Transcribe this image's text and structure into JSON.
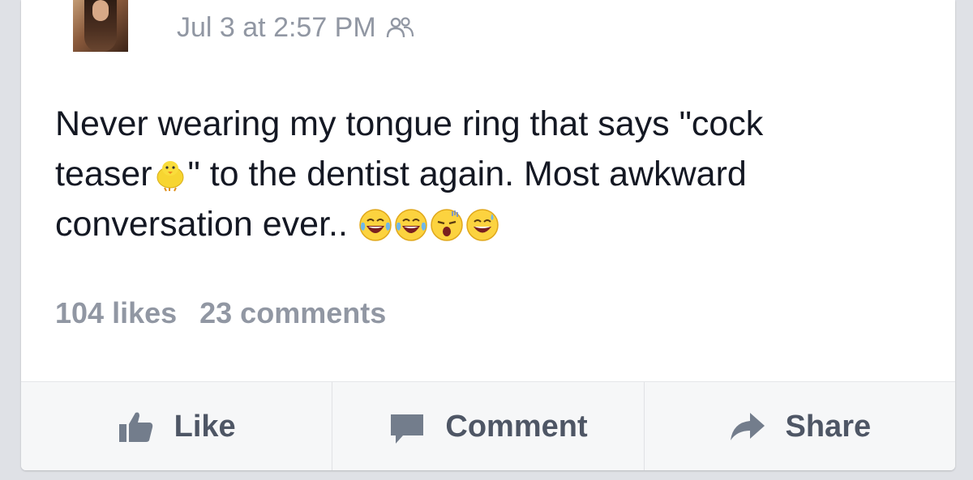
{
  "post": {
    "timestamp": "Jul 3 at 2:57 PM",
    "audience_icon": "friends-icon",
    "text_line1": "Never wearing my tongue ring that says \"cock",
    "text_line2_a": "teaser",
    "text_line2_b": "\" to the dentist again. Most awkward",
    "text_line3": "conversation ever.. ",
    "likes": "104 likes",
    "comments": "23 comments"
  },
  "actions": {
    "like_label": "Like",
    "comment_label": "Comment",
    "share_label": "Share"
  },
  "colors": {
    "text": "#141823",
    "meta": "#9197a3",
    "action_text": "#4e5665",
    "action_bg": "#f6f7f8"
  }
}
